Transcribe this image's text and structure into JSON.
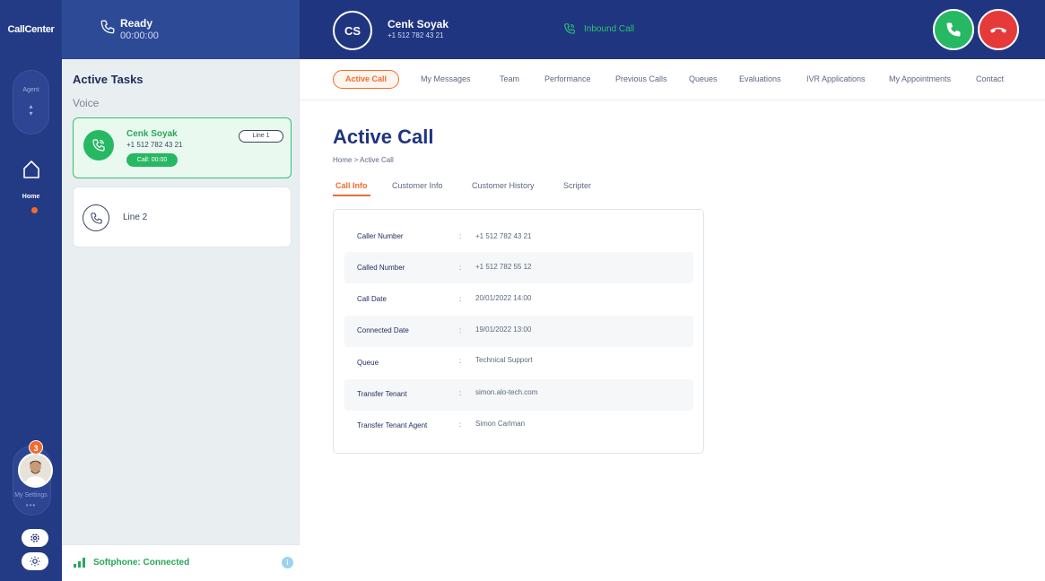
{
  "app": {
    "logo": "CallCenter"
  },
  "rail": {
    "agent_label": "Agent",
    "home_label": "Home",
    "notifications": "3",
    "settings_label": "My Settings",
    "settings_dots": "•••"
  },
  "status": {
    "title": "Ready",
    "time": "00:00:00"
  },
  "call": {
    "initials": "CS",
    "name": "Cenk Soyak",
    "number": "+1 512 782 43 21",
    "direction": "Inbound Call"
  },
  "tasks": {
    "title": "Active Tasks",
    "section": "Voice",
    "cards": [
      {
        "name": "Cenk Soyak",
        "number": "+1 512 782 43 21",
        "timer": "Call: 00:00",
        "line": "Line 1"
      },
      {
        "label": "Line 2"
      }
    ],
    "softphone": "Softphone: Connected",
    "info_icon": "i"
  },
  "nav": {
    "items": [
      "Active Call",
      "My Messages",
      "Team",
      "Performance",
      "Previous Calls",
      "Queues",
      "Evaluations",
      "IVR Applications",
      "My Appointments",
      "Contact"
    ]
  },
  "page": {
    "title": "Active Call",
    "breadcrumb": "Home > Active Call",
    "subtabs": [
      "Call Info",
      "Customer Info",
      "Customer History",
      "Scripter"
    ]
  },
  "call_info": {
    "rows": [
      {
        "label": "Caller Number",
        "value": "+1 512 782 43 21"
      },
      {
        "label": "Called Number",
        "value": "+1 512 782 55 12"
      },
      {
        "label": "Call Date",
        "value": "20/01/2022 14:00"
      },
      {
        "label": "Connected Date",
        "value": "19/01/2022 13:00"
      },
      {
        "label": "Queue",
        "value": "Technical Support"
      },
      {
        "label": "Transfer Tenant",
        "value": "simon.alo-tech.com"
      },
      {
        "label": "Transfer Tenant Agent",
        "value": "Simon Carlman"
      }
    ],
    "colon": ":"
  },
  "colors": {
    "primary": "#1f3580",
    "accent": "#f26b2a",
    "success": "#27b863",
    "danger": "#e63a3a"
  }
}
